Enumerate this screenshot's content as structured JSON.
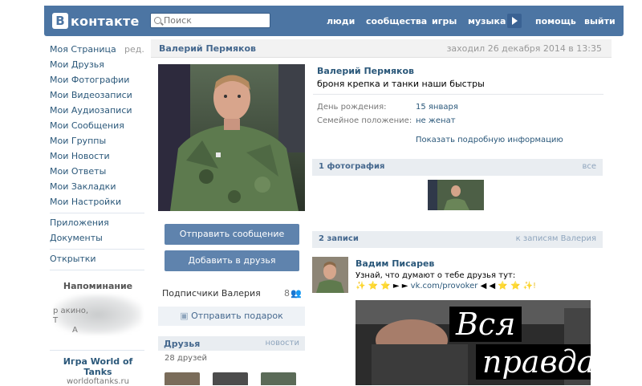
{
  "topbar": {
    "logo_letter": "В",
    "logo_text": "контакте",
    "search_placeholder": "Поиск",
    "nav": [
      "люди",
      "сообщества",
      "игры",
      "музыка",
      "помощь",
      "выйти"
    ]
  },
  "left_menu": {
    "items": [
      "Моя Страница",
      "Мои Друзья",
      "Мои Фотографии",
      "Мои Видеозаписи",
      "Мои Аудиозаписи",
      "Мои Сообщения",
      "Мои Группы",
      "Мои Новости",
      "Мои Ответы",
      "Мои Закладки",
      "Мои Настройки"
    ],
    "edit_label": "ред.",
    "extra_items": [
      "Приложения",
      "Документы"
    ],
    "cards_item": "Открытки",
    "ad": {
      "title": "Напоминание",
      "blur_lines": [
        "р      акино,",
        "Т",
        "А"
      ],
      "game_title": "Игра World of Tanks",
      "game_url": "worldoftanks.ru"
    }
  },
  "profile": {
    "name": "Валерий Пермяков",
    "last_seen": "заходил 26 декабря 2014 в 13:35",
    "status": "броня крепка и танки наши быстры",
    "birthday_label": "День рождения:",
    "birthday_value": "15 января",
    "family_label": "Семейное положение:",
    "family_value": "не женат",
    "show_more": "Показать подробную информацию",
    "send_message_button": "Отправить сообщение",
    "add_friend_button": "Добавить в друзья",
    "subscribers_label": "Подписчики Валерия",
    "subscribers_count": "8",
    "send_gift": "Отправить подарок",
    "friends_title": "Друзья",
    "friends_link": "новости",
    "friends_count": "28 друзей"
  },
  "photos": {
    "title": "1 фотография",
    "link": "все"
  },
  "wall": {
    "title": "2 записи",
    "link": "к записям Валерия",
    "post": {
      "author": "Вадим Писарев",
      "text": "Узнай, что думают о тебе друзья тут:",
      "link_text": "vk.com/provoker",
      "image_caption_1": "Вся",
      "image_caption_2": "правда"
    }
  },
  "colors": {
    "header_blue": "#4c75a3",
    "link_blue": "#2b587a",
    "button_blue": "#5f83ad"
  }
}
